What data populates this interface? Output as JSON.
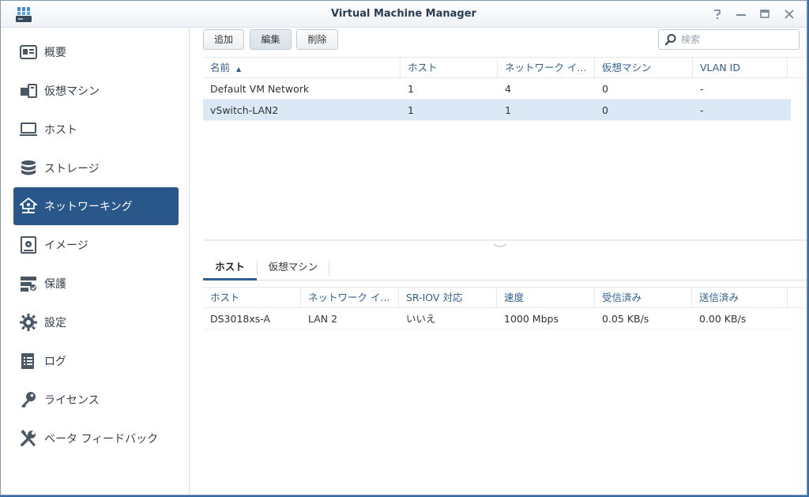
{
  "window": {
    "title": "Virtual Machine Manager"
  },
  "sidebar": {
    "items": [
      {
        "label": "概要",
        "icon": "overview-icon"
      },
      {
        "label": "仮想マシン",
        "icon": "vm-icon"
      },
      {
        "label": "ホスト",
        "icon": "host-icon"
      },
      {
        "label": "ストレージ",
        "icon": "storage-icon"
      },
      {
        "label": "ネットワーキング",
        "icon": "network-icon",
        "active": true
      },
      {
        "label": "イメージ",
        "icon": "image-icon"
      },
      {
        "label": "保護",
        "icon": "protection-icon"
      },
      {
        "label": "設定",
        "icon": "gear-icon"
      },
      {
        "label": "ログ",
        "icon": "log-icon"
      },
      {
        "label": "ライセンス",
        "icon": "key-icon"
      },
      {
        "label": "ベータ フィードバック",
        "icon": "wrench-icon"
      }
    ]
  },
  "toolbar": {
    "add_label": "追加",
    "edit_label": "編集",
    "delete_label": "削除",
    "search_placeholder": "検索"
  },
  "network_table": {
    "columns": [
      "名前",
      "ホスト",
      "ネットワーク イ...",
      "仮想マシン",
      "VLAN ID"
    ],
    "sort_indicator": "▲",
    "rows": [
      [
        "Default VM Network",
        "1",
        "4",
        "0",
        "-"
      ],
      [
        "vSwitch-LAN2",
        "1",
        "1",
        "0",
        "-"
      ]
    ],
    "selected_row": 1
  },
  "subtabs": [
    "ホスト",
    "仮想マシン"
  ],
  "host_table": {
    "columns": [
      "ホスト",
      "ネットワーク イ...",
      "SR-IOV 対応",
      "速度",
      "受信済み",
      "送信済み"
    ],
    "rows": [
      [
        "DS3018xs-A",
        "LAN 2",
        "いいえ",
        "1000 Mbps",
        "0.05 KB/s",
        "0.00 KB/s"
      ]
    ]
  },
  "colors": {
    "accent": "#29578a",
    "header_text": "#2f5f91",
    "selected_row": "#dbe9f7"
  }
}
